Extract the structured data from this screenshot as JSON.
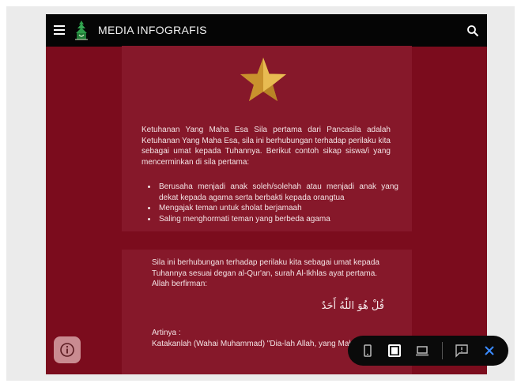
{
  "header": {
    "title": "MEDIA INFOGRAFIS"
  },
  "card1": {
    "intro": "Ketuhanan Yang Maha Esa Sila pertama dari Pancasila adalah Ketuhanan Yang Maha Esa, sila ini berhubungan terhadap perilaku kita sebagai umat kepada Tuhannya. Berikut contoh sikap siswa/i yang mencerminkan di sila pertama:",
    "bullets": [
      "Berusaha menjadi anak soleh/solehah atau menjadi anak yang dekat kepada agama serta berbakti kepada orangtua",
      "Mengajak teman untuk sholat berjamaah",
      "Saling menghormati teman yang berbeda agama"
    ]
  },
  "card2": {
    "intro": "Sila ini berhubungan terhadap perilaku kita sebagai umat kepada Tuhannya sesuai degan al-Qur'an, surah Al-Ikhlas  ayat pertama. Allah berfirman:",
    "arabic": "قُلْ هُوَ اللّٰهُ أَحَدٌ",
    "artinya_label": "Artinya :",
    "artinya_text": "Katakanlah (Wahai Muhammad) \"Dia-lah Allah, yang Maha Esa\""
  },
  "icons": {
    "menu": "hamburger-icon",
    "logo": "logo-icon",
    "search": "search-icon",
    "star": "star-icon",
    "info": "info-icon",
    "phone": "phone-icon",
    "tablet": "tablet-icon",
    "laptop": "laptop-icon",
    "feedback": "feedback-icon",
    "close": "close-icon"
  },
  "colors": {
    "background": "#7b0c1d",
    "card": "#86182a",
    "topbar": "#050505",
    "accent": "#3b8bff",
    "star": "#e0b040"
  }
}
